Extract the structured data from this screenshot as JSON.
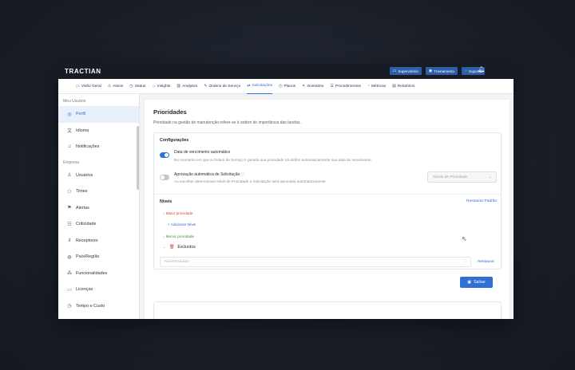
{
  "brand": {
    "logo": "TRACTIAN"
  },
  "topbar": {
    "buttons": [
      {
        "label": "Supervisório",
        "icon": "monitor-icon"
      },
      {
        "label": "Treinamento",
        "icon": "eye-icon"
      },
      {
        "label": "Suporte",
        "icon": "chat-icon"
      }
    ],
    "bell_icon": "bell-icon"
  },
  "nav": {
    "items": [
      {
        "label": "Visão Geral",
        "icon": "monitor-icon"
      },
      {
        "label": "Ativos",
        "icon": "assets-icon"
      },
      {
        "label": "Status",
        "icon": "status-icon"
      },
      {
        "label": "Insights",
        "icon": "bulb-icon"
      },
      {
        "label": "Analytics",
        "icon": "chart-icon"
      },
      {
        "label": "Ordens de Serviço",
        "icon": "edit-icon"
      },
      {
        "label": "Solicitações",
        "icon": "request-icon"
      },
      {
        "label": "Planos",
        "icon": "clock-icon"
      },
      {
        "label": "Inventário",
        "icon": "tools-icon"
      },
      {
        "label": "Procedimentos",
        "icon": "list-icon"
      },
      {
        "label": "Métricas",
        "icon": "gauge-icon"
      },
      {
        "label": "Relatórios",
        "icon": "report-icon"
      }
    ],
    "active": "Solicitações"
  },
  "sidebar": {
    "section_user": "Meu Usuário",
    "user_items": [
      {
        "label": "Perfil",
        "icon": "profile-icon"
      },
      {
        "label": "Idioma",
        "icon": "language-icon"
      },
      {
        "label": "Notificações",
        "icon": "bell-icon"
      }
    ],
    "section_company": "Empresa",
    "company_items": [
      {
        "label": "Usuários",
        "icon": "user-icon"
      },
      {
        "label": "Times",
        "icon": "team-icon"
      },
      {
        "label": "Alertas",
        "icon": "alert-icon"
      },
      {
        "label": "Criticidade",
        "icon": "criticality-icon"
      },
      {
        "label": "Receptores",
        "icon": "receptor-icon"
      },
      {
        "label": "País/Região",
        "icon": "globe-icon"
      },
      {
        "label": "Funcionalidades",
        "icon": "features-icon"
      },
      {
        "label": "Licenças",
        "icon": "license-icon"
      },
      {
        "label": "Tempo e Custo",
        "icon": "time-icon"
      }
    ],
    "active": "Perfil"
  },
  "page": {
    "title": "Prioridades",
    "subtitle": "Prioridade na gestão de manutenção refere-se à ordem de importância das tarefas.",
    "config_title": "Configurações",
    "option1": {
      "title": "Data de vencimento automático",
      "desc": "No momento em que a Ordem de Serviço é gerada sua prioridade irá definir automaticamente sua data de vencimento.",
      "enabled": true
    },
    "option2": {
      "title": "Aprovação automática de Solicitação",
      "desc": "Ao escolher determinado Nível de Prioridade a Solicitação será aprovada automaticamente.",
      "enabled": false,
      "select_placeholder": "Níveis de Prioridade"
    },
    "levels": {
      "title": "Níveis",
      "restore_default": "Restaurar Padrão",
      "max_priority": "Maior prioridade",
      "add_level": "Adicionar Nível",
      "min_priority": "Menor prioridade",
      "excluded": "Excluídos",
      "excluded_placeholder": "Nível Excluído",
      "restore": "Restaurar"
    },
    "save_label": "Salvar"
  },
  "colors": {
    "accent": "#2f6fd6",
    "topbar": "#171b24",
    "danger": "#d64545",
    "success": "#3a9a3a"
  }
}
